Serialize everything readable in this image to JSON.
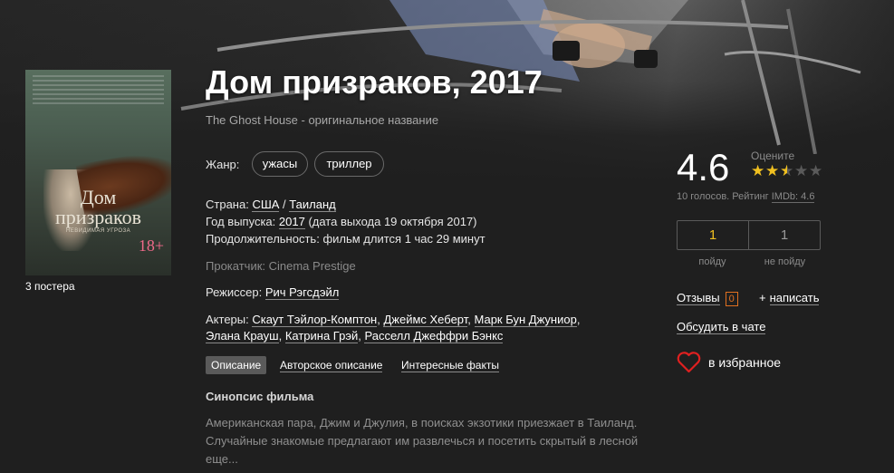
{
  "movie": {
    "title": "Дом призраков, 2017",
    "original_title": "The Ghost House - оригинальное название"
  },
  "poster": {
    "title_line1": "Дом",
    "title_line2": "призраков",
    "subtitle": "НЕВИДИМАЯ УГРОЗА",
    "age": "18+",
    "count_label": "3 постера"
  },
  "genre": {
    "label": "Жанр:",
    "items": [
      "ужасы",
      "триллер"
    ]
  },
  "country": {
    "label": "Страна:",
    "values": [
      "США",
      "Таиланд"
    ],
    "sep": " / "
  },
  "year": {
    "label": "Год выпуска:",
    "value": "2017",
    "release": "(дата выхода 19 октября 2017)"
  },
  "duration": {
    "label": "Продолжительность:",
    "value": "фильм длится 1 час 29 минут"
  },
  "distributor": {
    "text": "Прокатчик: Cinema Prestige"
  },
  "director": {
    "label": "Режиссер:",
    "name": "Рич Рэгсдэйл"
  },
  "actors": {
    "label": "Актеры:",
    "line1": [
      "Скаут Тэйлор-Комптон",
      "Джеймс Хеберт",
      "Марк Бун Джуниор"
    ],
    "line2": [
      "Элана Крауш",
      "Катрина Грэй",
      "Расселл Джеффри Бэнкс"
    ]
  },
  "tabs": [
    {
      "label": "Описание",
      "active": true
    },
    {
      "label": "Авторское описание",
      "active": false
    },
    {
      "label": "Интересные факты",
      "active": false
    }
  ],
  "synopsis": {
    "title": "Синопсис фильма",
    "text": "Американская пара, Джим и Джулия, в поисках экзотики приезжает в Таиланд. Случайные знакомые предлагают им развлечься и посетить скрытый в лесной еще..."
  },
  "rating": {
    "value": "4.6",
    "rate_label": "Оцените",
    "stars_filled": 2.5,
    "stars_total": 5,
    "votes_text": "10 голосов. Рейтинг ",
    "imdb_text": "IMDb: 4.6"
  },
  "attendance": {
    "go_count": "1",
    "go_label": "пойду",
    "nogo_count": "1",
    "nogo_label": "не пойду"
  },
  "reviews": {
    "label": "Отзывы",
    "count": "0",
    "write_label": "написать",
    "chat_label": "Обсудить в чате"
  },
  "favorite": {
    "label": "в избранное"
  },
  "colors": {
    "accent": "#f0c020",
    "badge": "#e07020",
    "heart": "#e02020",
    "background": "#1f1f1f"
  }
}
